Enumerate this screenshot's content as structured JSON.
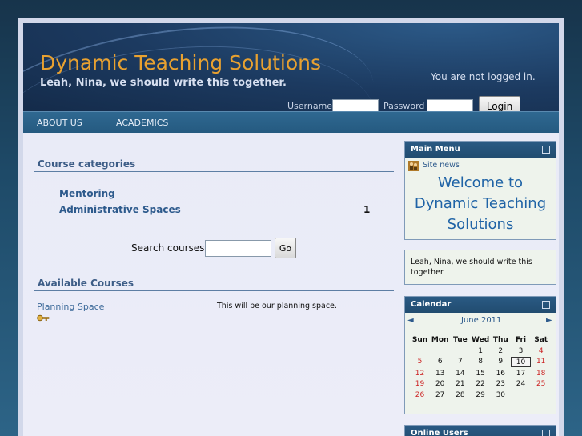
{
  "header": {
    "site_title": "Dynamic Teaching Solutions",
    "subtitle": "Leah, Nina, we should write this together.",
    "login_status": "You are not logged in.",
    "username_label": "Username",
    "password_label": "Password",
    "login_button": "Login"
  },
  "nav": {
    "items": [
      "ABOUT US",
      "ACADEMICS"
    ]
  },
  "categories": {
    "heading": "Course categories",
    "items": [
      {
        "label": "Mentoring",
        "count": ""
      },
      {
        "label": "Administrative Spaces",
        "count": "1"
      }
    ]
  },
  "search": {
    "label": "Search courses:",
    "value": "",
    "button": "Go"
  },
  "courses": {
    "heading": "Available Courses",
    "items": [
      {
        "name": "Planning Space",
        "description": "This will be our planning space."
      }
    ]
  },
  "main_menu": {
    "title": "Main Menu",
    "news_link": "Site news",
    "welcome": "Welcome to Dynamic Teaching Solutions"
  },
  "summary_block": {
    "text": "Leah, Nina, we should write this together."
  },
  "calendar": {
    "title": "Calendar",
    "prev": "◄",
    "next": "►",
    "month": "June 2011",
    "days_of_week": [
      "Sun",
      "Mon",
      "Tue",
      "Wed",
      "Thu",
      "Fri",
      "Sat"
    ],
    "weeks": [
      [
        "",
        "",
        "",
        "1",
        "2",
        "3",
        "4"
      ],
      [
        "5",
        "6",
        "7",
        "8",
        "9",
        "10",
        "11"
      ],
      [
        "12",
        "13",
        "14",
        "15",
        "16",
        "17",
        "18"
      ],
      [
        "19",
        "20",
        "21",
        "22",
        "23",
        "24",
        "25"
      ],
      [
        "26",
        "27",
        "28",
        "29",
        "30",
        "",
        ""
      ]
    ],
    "today": "10",
    "weekend_color": "#cc2222"
  },
  "online_users": {
    "title": "Online Users"
  },
  "colors": {
    "title_accent": "#e8a130",
    "link": "#2d5a8c",
    "header_bg": "#1c3a60"
  }
}
